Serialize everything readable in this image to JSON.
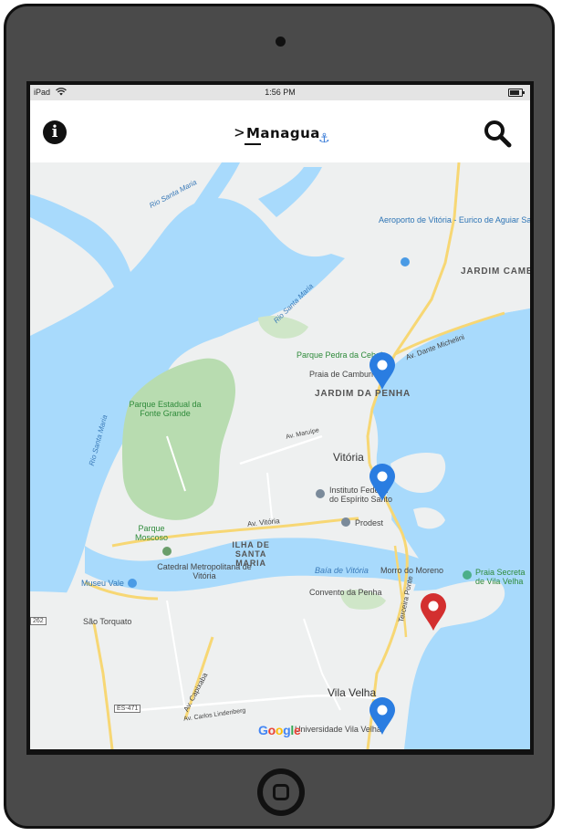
{
  "status": {
    "carrier": "iPad",
    "time": "1:56 PM"
  },
  "navbar": {
    "title": "Managua",
    "caret": ">"
  },
  "map": {
    "labels": {
      "airport": "Aeroporto de Vitória - Eurico de Aguiar Salles",
      "jardim_camburi": "JARDIM CAMBURI",
      "jardim_da_penha": "JARDIM DA PENHA",
      "parque_pedra": "Parque Pedra da Cebola",
      "praia_camburi": "Praia de Camburi",
      "av_dante": "Av. Dante Michelini",
      "parque_estadual": "Parque Estadual da Fonte Grande",
      "vitoria": "Vitória",
      "instituto": "Instituto Federal do Espírito Santo",
      "prodest": "Prodest",
      "av_vitoria": "Av. Vitória",
      "ilha_santa_maria": "ILHA DE SANTA MARIA",
      "parque_moscoso": "Parque Moscoso",
      "catedral": "Catedral Metropolitana de Vitória",
      "museu_vale": "Museu Vale",
      "sao_torquato": "São Torquato",
      "baia_vitoria": "Baía de Vitória",
      "convento": "Convento da Penha",
      "morro_moreno": "Morro do Moreno",
      "praia_secreta": "Praia Secreta de Vila Velha",
      "terceira_ponte": "Terceira Ponte",
      "vila_velha": "Vila Velha",
      "universidade": "Universidade Vila Velha",
      "rio_santa_maria_1": "Rio Santa Maria",
      "rio_santa_maria_2": "Rio Santa Maria",
      "rio_santa_maria_3": "Rio Santa Maria",
      "av_maruipe": "Av. Maruípe",
      "av_capixaba": "Av. Capixaba",
      "av_carlos_lindenberg": "Av. Carlos Lindenberg",
      "es471": "ES-471",
      "route_262": "262"
    },
    "markers": [
      {
        "name": "marker-1",
        "color": "#2a7de1"
      },
      {
        "name": "marker-2",
        "color": "#2a7de1"
      },
      {
        "name": "marker-3",
        "color": "#d32f2f"
      },
      {
        "name": "marker-4",
        "color": "#2a7de1"
      }
    ],
    "attribution": "Google"
  },
  "colors": {
    "device": "#4a4a4a",
    "water": "#a8dafc",
    "land": "#eef0f0",
    "park": "#b8dcb0",
    "road": "#f7d774",
    "marker_blue": "#2a7de1",
    "marker_red": "#d32f2f"
  }
}
